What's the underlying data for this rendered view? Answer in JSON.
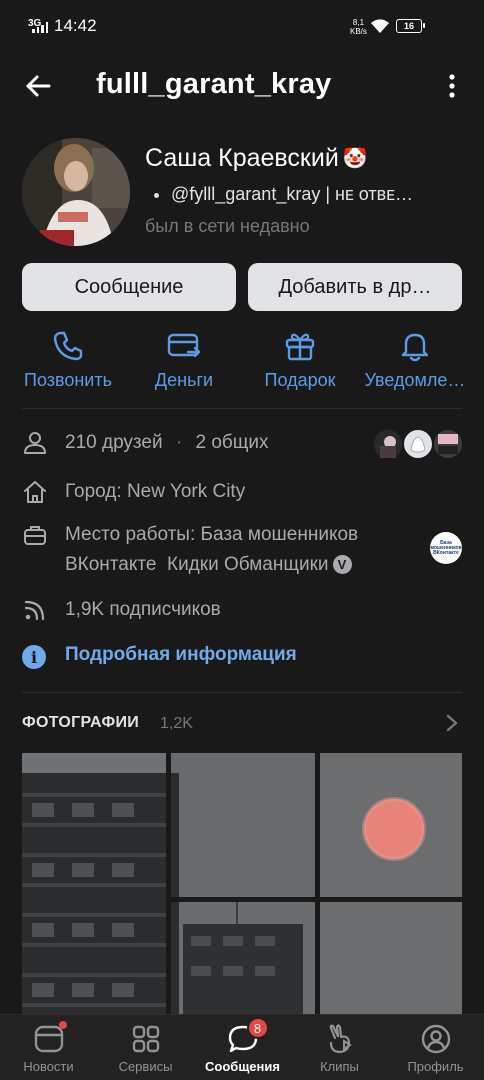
{
  "status_bar": {
    "network": "3G",
    "time": "14:42",
    "speed_value": "8,1",
    "speed_unit": "KB/s",
    "battery": "16"
  },
  "header": {
    "title": "fulll_garant_kray",
    "back_icon": "arrow-left-icon",
    "menu_icon": "more-vertical-icon"
  },
  "profile": {
    "name": "Саша Краевский",
    "name_emoji": "🤡",
    "status": "@fylll_garant_kray | нᴇ отвᴇ…",
    "last_seen": "был в сети недавно"
  },
  "buttons": {
    "message": "Сообщение",
    "add_friend": "Добавить в др…"
  },
  "actions": [
    {
      "label": "Позвонить",
      "icon": "phone-icon"
    },
    {
      "label": "Деньги",
      "icon": "money-transfer-icon"
    },
    {
      "label": "Подарок",
      "icon": "gift-icon"
    },
    {
      "label": "Уведомле…",
      "icon": "bell-icon"
    }
  ],
  "info": {
    "friends": "210 друзей",
    "mutual": "2 общих",
    "city": "Город: New York City",
    "work_line1": "Место работы: База мошенников",
    "work_line2": "ВКонтакте  Кидки Обманщики",
    "verified_mark": "V",
    "work_logo_text": "База мошенников ВКонтакте",
    "followers": "1,9K подписчиков",
    "more_info": "Подробная информация",
    "info_mark": "i"
  },
  "photos": {
    "title": "ФОТОГРАФИИ",
    "count": "1,2K"
  },
  "tabbar": [
    {
      "label": "Новости",
      "icon": "news-icon",
      "active": false
    },
    {
      "label": "Сервисы",
      "icon": "services-icon",
      "active": false
    },
    {
      "label": "Сообщения",
      "icon": "messages-icon",
      "active": true,
      "badge": "8"
    },
    {
      "label": "Клипы",
      "icon": "clips-icon",
      "active": false
    },
    {
      "label": "Профиль",
      "icon": "profile-icon",
      "active": false
    }
  ],
  "colors": {
    "background": "#19191a",
    "accent": "#71aaeb",
    "action_blue": "#5c9ce6",
    "badge": "#e64646",
    "button": "#e1e3e6"
  }
}
